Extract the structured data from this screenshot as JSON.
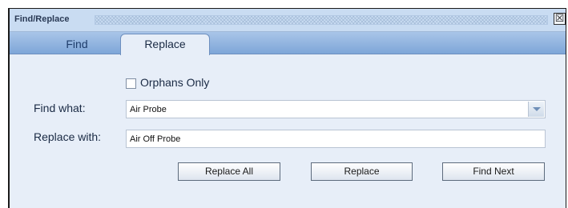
{
  "window": {
    "title": "Find/Replace",
    "close_glyph": "☒"
  },
  "tabs": [
    {
      "label": "Find",
      "active": false
    },
    {
      "label": "Replace",
      "active": true
    }
  ],
  "options": {
    "orphans_only": {
      "label": "Orphans Only",
      "checked": false
    }
  },
  "find": {
    "label": "Find what:",
    "value": "Air Probe"
  },
  "replace": {
    "label": "Replace with:",
    "value": "Air Off Probe"
  },
  "buttons": {
    "replace_all": "Replace All",
    "replace": "Replace",
    "find_next": "Find Next"
  },
  "icons": {
    "close": "close-icon",
    "dropdown": "chevron-down-icon"
  },
  "colors": {
    "dialog_bg": "#e7eef8",
    "titlebar_bg": "#c9dcf2",
    "tabstrip_bg": "#7ea6d8"
  }
}
